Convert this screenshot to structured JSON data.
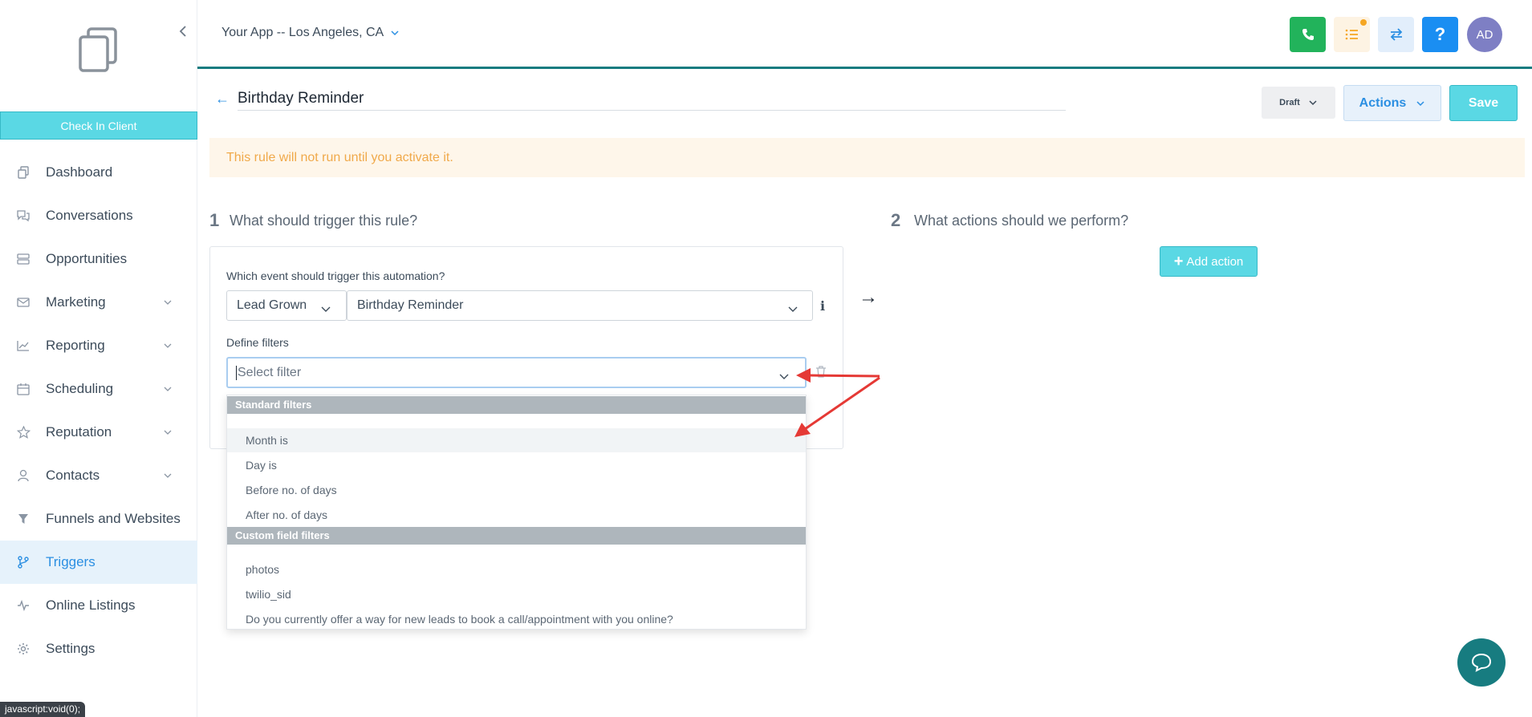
{
  "sidebar": {
    "check_in_label": "Check In Client",
    "items": [
      {
        "label": "Dashboard",
        "icon": "copy-icon",
        "chevron": false
      },
      {
        "label": "Conversations",
        "icon": "chat-bubbles-icon",
        "chevron": false
      },
      {
        "label": "Opportunities",
        "icon": "stack-icon",
        "chevron": false
      },
      {
        "label": "Marketing",
        "icon": "mail-icon",
        "chevron": true
      },
      {
        "label": "Reporting",
        "icon": "line-chart-icon",
        "chevron": true
      },
      {
        "label": "Scheduling",
        "icon": "calendar-icon",
        "chevron": true
      },
      {
        "label": "Reputation",
        "icon": "star-icon",
        "chevron": true
      },
      {
        "label": "Contacts",
        "icon": "user-icon",
        "chevron": true
      },
      {
        "label": "Funnels and Websites",
        "icon": "filter-icon",
        "chevron": false
      },
      {
        "label": "Triggers",
        "icon": "branch-icon",
        "chevron": false,
        "active": true
      },
      {
        "label": "Online Listings",
        "icon": "pulse-icon",
        "chevron": false
      },
      {
        "label": "Settings",
        "icon": "gear-icon",
        "chevron": false
      }
    ]
  },
  "header": {
    "location": "Your App -- Los Angeles, CA",
    "avatar_initials": "AD",
    "help_label": "?"
  },
  "rule": {
    "title": "Birthday Reminder",
    "status": "Draft",
    "actions_label": "Actions",
    "save_label": "Save",
    "warning": "This rule will not run until you activate it."
  },
  "trigger_section": {
    "number": "1",
    "title": "What should trigger this rule?",
    "event_label": "Which event should trigger this automation?",
    "event_category": "Lead Grown",
    "event_type": "Birthday Reminder",
    "filters_label": "Define filters",
    "filter_placeholder": "Select filter"
  },
  "dropdown": {
    "standard_header": "Standard filters",
    "standard_options": [
      "Month is",
      "Day is",
      "Before no. of days",
      "After no. of days"
    ],
    "custom_header": "Custom field filters",
    "custom_options": [
      "photos",
      "twilio_sid",
      "Do you currently offer a way for new leads to book a call/appointment with you online?"
    ]
  },
  "actions_section": {
    "number": "2",
    "title": "What actions should we perform?",
    "add_action_label": "Add action"
  },
  "status_bar": "javascript:void(0);",
  "colors": {
    "accent": "#5ad8e4",
    "primary_blue": "#2b8fe2",
    "header_border": "#177c80",
    "annotation_red": "#e53935"
  }
}
